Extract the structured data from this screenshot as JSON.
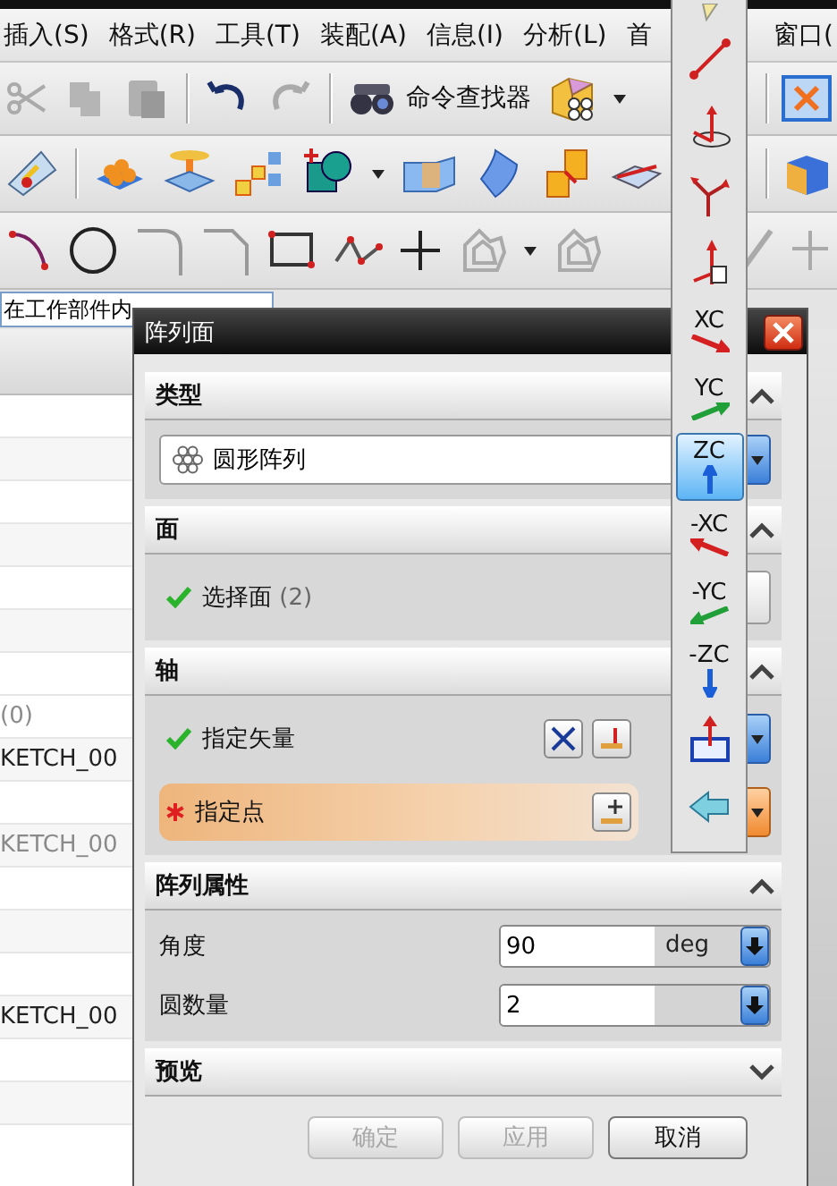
{
  "menu": [
    {
      "label": "插入(S)"
    },
    {
      "label": "格式(R)"
    },
    {
      "label": "工具(T)"
    },
    {
      "label": "装配(A)"
    },
    {
      "label": "信息(I)"
    },
    {
      "label": "分析(L)"
    },
    {
      "label": "首"
    },
    {
      "label": "窗口("
    }
  ],
  "toolbar": {
    "command_finder": "命令查找器"
  },
  "part_navigator": {
    "filter": "在工作部件内",
    "rows": [
      {
        "kind": "item",
        "text": "(0)",
        "dim": true
      },
      {
        "kind": "item",
        "text": "KETCH_00",
        "dim": false
      },
      {
        "kind": "blank"
      },
      {
        "kind": "item",
        "text": "KETCH_00",
        "dim": true
      },
      {
        "kind": "blank"
      },
      {
        "kind": "blank"
      },
      {
        "kind": "blank"
      },
      {
        "kind": "item",
        "text": "KETCH_00",
        "dim": false
      },
      {
        "kind": "blank"
      },
      {
        "kind": "blank"
      }
    ]
  },
  "dialog": {
    "title": "阵列面",
    "sections": [
      {
        "title": "类型",
        "expanded": true,
        "kind": "dropdown",
        "value": "圆形阵列"
      },
      {
        "title": "面",
        "expanded": true,
        "kind": "selection",
        "items": [
          {
            "kind": "face",
            "label": "选择面",
            "count": "(2)",
            "required": false,
            "active": false
          }
        ]
      },
      {
        "title": "轴",
        "expanded": true,
        "kind": "selection",
        "items": [
          {
            "kind": "vector",
            "label": "指定矢量",
            "required": false,
            "active": false
          },
          {
            "kind": "point",
            "label": "指定点",
            "required": true,
            "active": true
          }
        ]
      },
      {
        "title": "阵列属性",
        "expanded": true,
        "kind": "fields",
        "fields": [
          {
            "label": "角度",
            "value": "90",
            "unit": "deg"
          },
          {
            "label": "圆数量",
            "value": "2"
          }
        ]
      },
      {
        "title": "预览",
        "expanded": false
      }
    ],
    "buttons": [
      {
        "label": "确定",
        "disabled": true
      },
      {
        "label": "应用",
        "disabled": true
      },
      {
        "label": "取消",
        "disabled": false
      }
    ]
  },
  "vector_menu": {
    "items": [
      {
        "kind": "partial",
        "selected": false
      },
      {
        "kind": "points",
        "selected": false
      },
      {
        "kind": "rotate",
        "selected": false
      },
      {
        "kind": "bisector",
        "selected": false
      },
      {
        "kind": "cone",
        "selected": false
      },
      {
        "kind": "xaxis",
        "label": "XC",
        "negative": false,
        "color": "#d42020",
        "selected": false
      },
      {
        "kind": "yaxis",
        "label": "YC",
        "negative": false,
        "color": "#21a03a",
        "selected": false
      },
      {
        "kind": "zaxis",
        "label": "ZC",
        "negative": false,
        "color": "#1a5fd8",
        "selected": true
      },
      {
        "kind": "xaxis",
        "label": "-XC",
        "negative": true,
        "color": "#d42020",
        "selected": false
      },
      {
        "kind": "yaxis",
        "label": "-YC",
        "negative": true,
        "color": "#21a03a",
        "selected": false
      },
      {
        "kind": "zaxis",
        "label": "-ZC",
        "negative": true,
        "color": "#1a5fd8",
        "selected": false
      },
      {
        "kind": "plane",
        "selected": false
      },
      {
        "kind": "reverse",
        "selected": false
      }
    ]
  }
}
